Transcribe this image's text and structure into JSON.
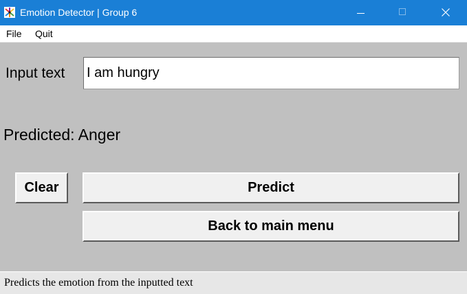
{
  "window": {
    "title": "Emotion Detector | Group 6",
    "app_icon": "feather-color-icon",
    "controls": [
      "minimize-icon",
      "maximize-icon",
      "close-icon"
    ]
  },
  "menu": {
    "items": [
      {
        "label": "File"
      },
      {
        "label": "Quit"
      }
    ]
  },
  "form": {
    "input_label": "Input text",
    "input_value": "I am hungry",
    "predicted_text": "Predicted: Anger"
  },
  "buttons": {
    "clear": "Clear",
    "predict": "Predict",
    "back": "Back to main menu"
  },
  "status": {
    "text": "Predicts the emotion from the inputted text"
  },
  "colors": {
    "titlebar": "#1a7fd6",
    "content_bg": "#c0c0c0",
    "button_bg": "#f0f0f0",
    "statusbar_bg": "#e7e7e7"
  }
}
